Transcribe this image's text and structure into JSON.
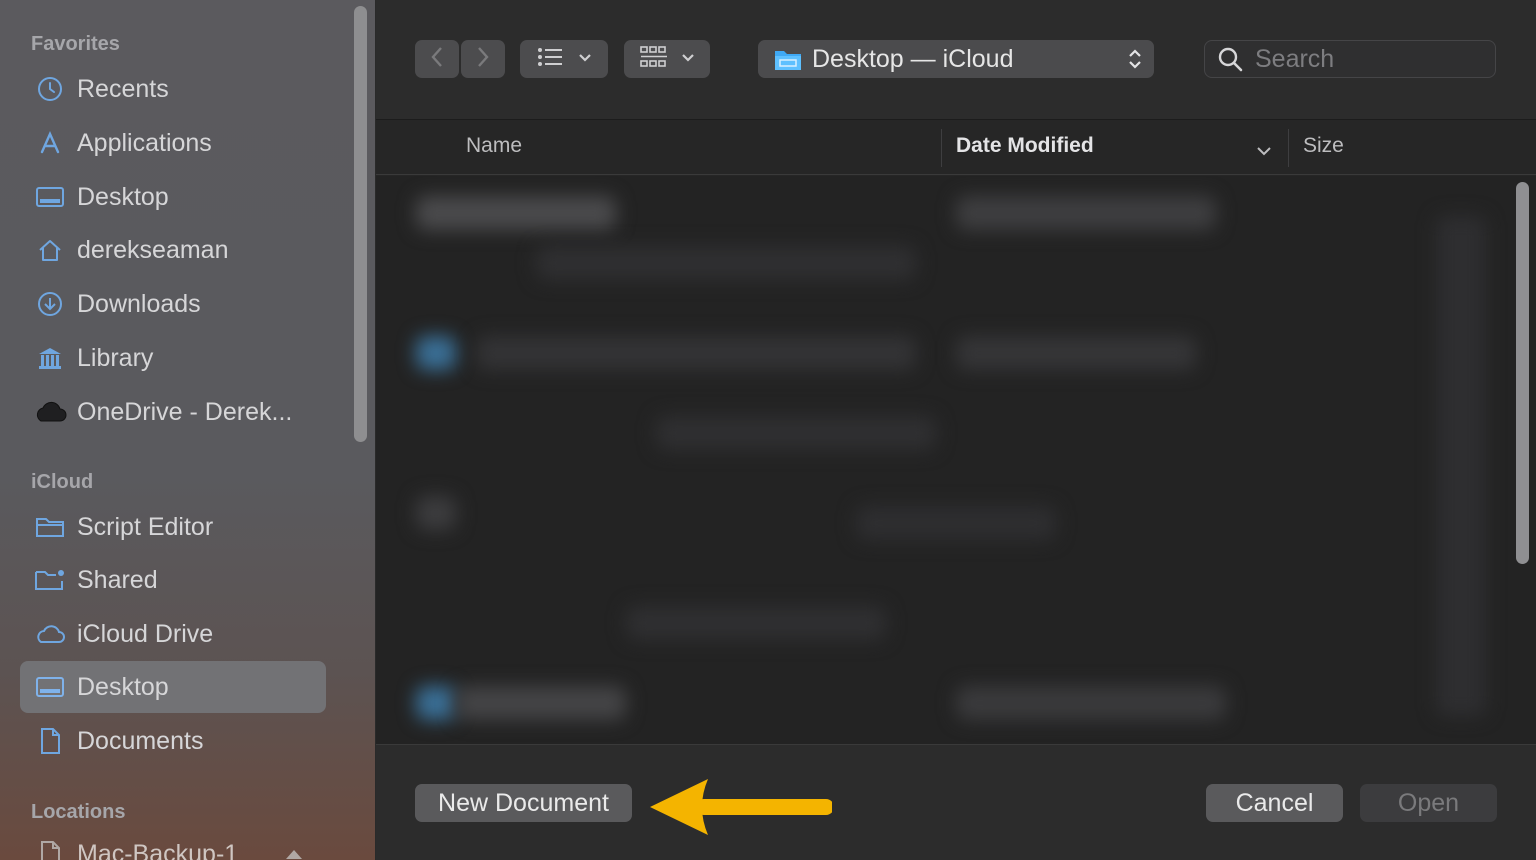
{
  "sidebar": {
    "favorites_title": "Favorites",
    "favorites": [
      {
        "label": "Recents",
        "icon": "clock-icon"
      },
      {
        "label": "Applications",
        "icon": "applications-icon"
      },
      {
        "label": "Desktop",
        "icon": "desktop-icon"
      },
      {
        "label": "derekseaman",
        "icon": "home-icon"
      },
      {
        "label": "Downloads",
        "icon": "downloads-icon"
      },
      {
        "label": "Library",
        "icon": "library-icon"
      },
      {
        "label": "OneDrive - Derek...",
        "icon": "cloud-icon"
      }
    ],
    "icloud_title": "iCloud",
    "icloud": [
      {
        "label": "Script Editor",
        "icon": "folder-icon"
      },
      {
        "label": "Shared",
        "icon": "shared-folder-icon"
      },
      {
        "label": "iCloud Drive",
        "icon": "icloud-icon"
      },
      {
        "label": "Desktop",
        "icon": "desktop-icon",
        "selected": true
      },
      {
        "label": "Documents",
        "icon": "document-icon"
      }
    ],
    "locations_title": "Locations",
    "locations": [
      {
        "label": "Mac-Backup-1",
        "icon": "document-icon"
      }
    ]
  },
  "toolbar": {
    "path_label": "Desktop — iCloud",
    "search_placeholder": "Search"
  },
  "columns": {
    "name": "Name",
    "date_modified": "Date Modified",
    "size": "Size"
  },
  "footer": {
    "new_document": "New Document",
    "cancel": "Cancel",
    "open": "Open"
  },
  "colors": {
    "accent_arrow": "#f4b400",
    "folder_blue": "#3fa9f5"
  }
}
